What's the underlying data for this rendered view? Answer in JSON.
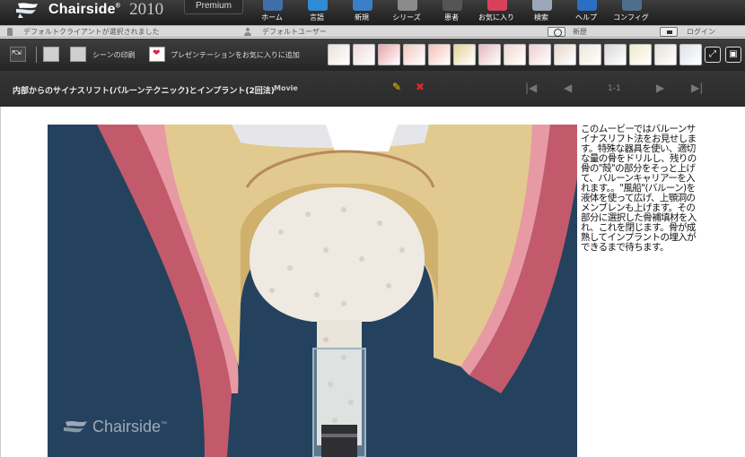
{
  "app": {
    "brand": "Chairside",
    "brand_mark": "®",
    "year": "2010",
    "edition": "Premium"
  },
  "nav": [
    {
      "label": "ホーム",
      "icon": "home-icon",
      "color": "#3f6fa8"
    },
    {
      "label": "言語",
      "icon": "language-icon",
      "color": "#2f8bd6"
    },
    {
      "label": "新規",
      "icon": "new-icon",
      "color": "#3a7ec8"
    },
    {
      "label": "シリーズ",
      "icon": "series-icon",
      "color": "#8a8a8a"
    },
    {
      "label": "患者",
      "icon": "patient-icon",
      "color": "#555555"
    },
    {
      "label": "お気に入り",
      "icon": "favorites-icon",
      "color": "#d8415c"
    },
    {
      "label": "検索",
      "icon": "search-icon",
      "color": "#9aa7b8"
    },
    {
      "label": "ヘルプ",
      "icon": "help-icon",
      "color": "#2b6fc5"
    },
    {
      "label": "コンフィグ",
      "icon": "config-icon",
      "color": "#4f6d8c"
    }
  ],
  "status": {
    "client": "デフォルトクライアントが選択されました",
    "user": "デフォルトユーザー",
    "history": "新歴",
    "login": "ログイン"
  },
  "toolbar": {
    "print_label": "シーンの印刷",
    "favorite_label": "プレゼンテーションをお気に入りに追加",
    "thumbnails": [
      {
        "name": "thumb-implant-tools",
        "color": "#e9e2d7"
      },
      {
        "name": "thumb-tooth-decay",
        "color": "#f0d8d8"
      },
      {
        "name": "thumb-gums",
        "color": "#e8a3a8"
      },
      {
        "name": "thumb-teeth-row",
        "color": "#f2c9c2"
      },
      {
        "name": "thumb-smile",
        "color": "#f5c0b8"
      },
      {
        "name": "thumb-roots",
        "color": "#e8d29a"
      },
      {
        "name": "thumb-crown",
        "color": "#e6b9bf"
      },
      {
        "name": "thumb-upper-arch",
        "color": "#f0d7cf"
      },
      {
        "name": "thumb-lower-arch",
        "color": "#efcfcf"
      },
      {
        "name": "thumb-implant",
        "color": "#e6d8cc"
      },
      {
        "name": "thumb-bridge",
        "color": "#eee6dc"
      },
      {
        "name": "thumb-xray",
        "color": "#d9d9d9"
      },
      {
        "name": "thumb-floss",
        "color": "#f1e9c9"
      },
      {
        "name": "thumb-veneers",
        "color": "#e6e2da"
      },
      {
        "name": "thumb-brush",
        "color": "#dde2ea"
      }
    ]
  },
  "movie": {
    "title": "内部からのサイナスリフト(バルーンテクニック)とインプラント(2回法)",
    "type": "Movie",
    "page": "1-1"
  },
  "media": {
    "watermark": "Chairside",
    "watermark_mark": "™"
  },
  "description": "このムービーではバルーンサイナスリフト法をお見せします。特殊な器具を使い、適切な量の骨をドリルし、残りの骨の\"殻\"の部分をそっと上げて、バルーンキャリアーを入れます。。\"風船\"(バルーン)を液体を使って広げ、上顎洞のメンブレンも上げます。その部分に選択した骨補填材を入れ、これを閉じます。骨が成熟してインプラントの埋入ができるまで待ちます。",
  "colors": {
    "background": "#24425e",
    "gum": "#d98a92",
    "bone": "#e2c98f",
    "graft": "#eeeae2"
  }
}
